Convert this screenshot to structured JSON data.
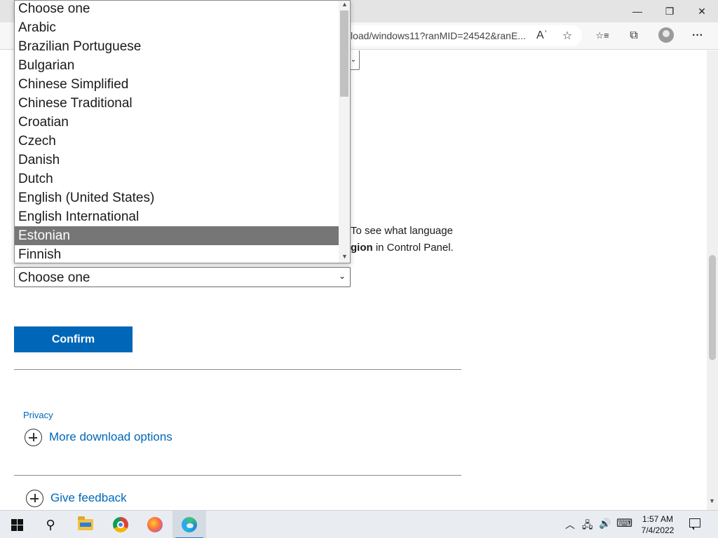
{
  "window": {
    "minimize_glyph": "—",
    "maximize_glyph": "❐",
    "close_glyph": "✕"
  },
  "toolbar": {
    "address_text": "load/windows11?ranMID=24542&ranE...",
    "read_aloud_glyph": "Aʾ",
    "add_favorite_glyph": "☆",
    "favorites_glyph": "☆≡",
    "collections_glyph": "⧉",
    "more_glyph": "···"
  },
  "dropdown": {
    "options": [
      "Choose one",
      "Arabic",
      "Brazilian Portuguese",
      "Bulgarian",
      "Chinese Simplified",
      "Chinese Traditional",
      "Croatian",
      "Czech",
      "Danish",
      "Dutch",
      "English (United States)",
      "English International",
      "Estonian",
      "Finnish"
    ],
    "highlighted_option": "Estonian",
    "scroll_up_glyph": "▲",
    "scroll_down_glyph": "▼"
  },
  "page": {
    "top_select_caret": "⌄",
    "info_line1": "To see what language",
    "info_line2_bold": "gion",
    "info_line2_rest": " in Control Panel.",
    "language_select": {
      "value": "Choose one",
      "caret": "⌄"
    },
    "confirm_label": "Confirm",
    "privacy_label": "Privacy",
    "more_download_label": "More download options",
    "give_feedback_label": "Give feedback",
    "scroll_down_glyph": "▼"
  },
  "taskbar": {
    "search_glyph": "⚲",
    "tray": {
      "chevron_glyph": "︿",
      "network_glyph": "🖧",
      "volume_glyph": "🔊",
      "keyboard_glyph": "⌨"
    },
    "time": "1:57 AM",
    "date": "7/4/2022"
  }
}
